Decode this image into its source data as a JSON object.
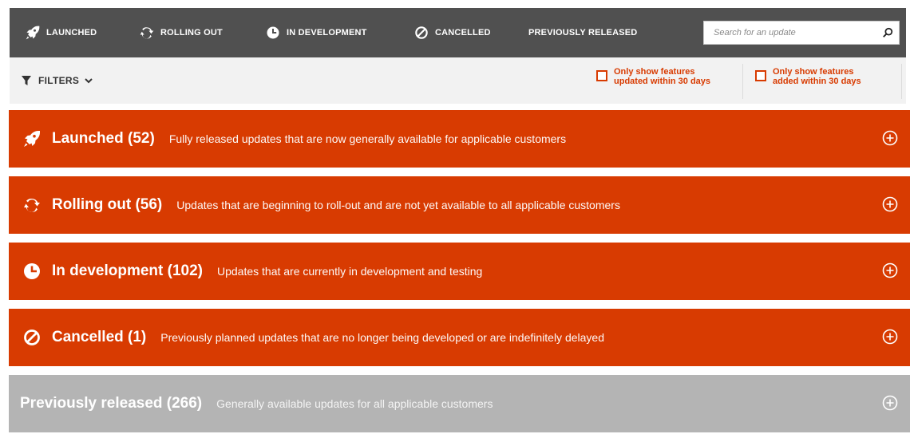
{
  "nav": {
    "items": [
      {
        "label": "LAUNCHED",
        "icon": "rocket-icon"
      },
      {
        "label": "ROLLING OUT",
        "icon": "refresh-icon"
      },
      {
        "label": "IN DEVELOPMENT",
        "icon": "clock-icon"
      },
      {
        "label": "CANCELLED",
        "icon": "ban-icon"
      },
      {
        "label": "PREVIOUSLY RELEASED",
        "icon": ""
      }
    ],
    "search_placeholder": "Search for an update"
  },
  "filterbar": {
    "filters_label": "FILTERS",
    "options": [
      {
        "line1": "Only show features",
        "line2": "updated within 30 days",
        "checked": false
      },
      {
        "line1": "Only show features",
        "line2": "added within 30 days",
        "checked": false
      }
    ]
  },
  "sections": [
    {
      "title": "Launched (52)",
      "description": "Fully released updates that are now generally available for applicable customers",
      "icon": "rocket-icon",
      "color": "#d83b01"
    },
    {
      "title": "Rolling out (56)",
      "description": "Updates that are beginning to roll-out and are not yet available to all applicable customers",
      "icon": "refresh-icon",
      "color": "#d83b01"
    },
    {
      "title": "In development (102)",
      "description": "Updates that are currently in development and testing",
      "icon": "clock-icon",
      "color": "#d83b01"
    },
    {
      "title": "Cancelled (1)",
      "description": "Previously planned updates that are no longer being developed or are indefinitely delayed",
      "icon": "ban-icon",
      "color": "#d83b01"
    },
    {
      "title": "Previously released (266)",
      "description": "Generally available updates for all applicable customers",
      "icon": "",
      "color": "#b4b4b4"
    }
  ],
  "colors": {
    "accent": "#d83b01",
    "nav_bg": "#505050",
    "muted": "#b4b4b4"
  }
}
